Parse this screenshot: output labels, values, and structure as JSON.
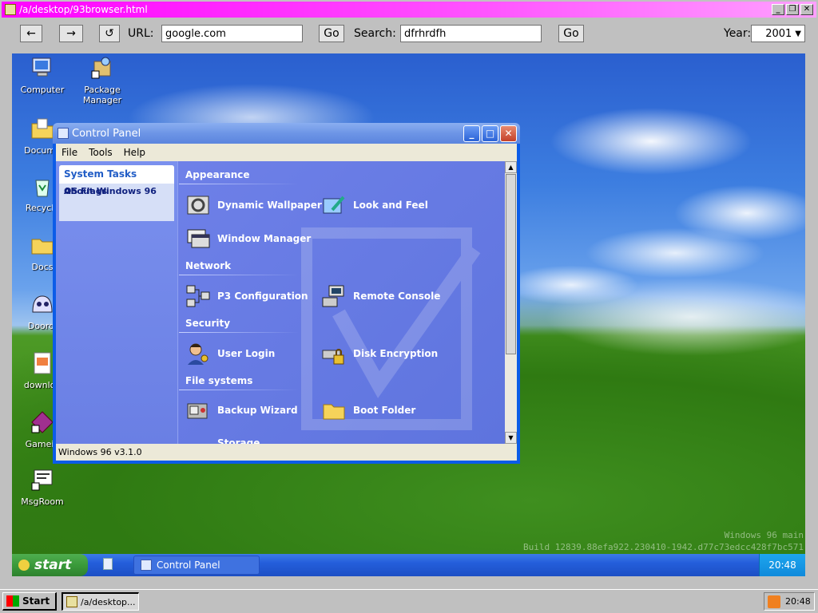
{
  "browser": {
    "title": "/a/desktop/93browser.html",
    "back": "←",
    "forward": "→",
    "reload": "↺",
    "url_label": "URL:",
    "url_value": "google.com",
    "go": "Go",
    "search_label": "Search:",
    "search_value": "dfrhrdfh",
    "go2": "Go",
    "year_label": "Year:",
    "year_value": "2001"
  },
  "desktop": {
    "icons": [
      {
        "label": "Computer",
        "icon": "computer-icon"
      },
      {
        "label": "Package Manager",
        "icon": "package-icon"
      },
      {
        "label": "Docume",
        "icon": "documents-icon"
      },
      {
        "label": "Recycle",
        "icon": "recycle-bin-icon"
      },
      {
        "label": "Docs",
        "icon": "folder-icon"
      },
      {
        "label": "Doordi",
        "icon": "doordiary-icon"
      },
      {
        "label": "downloa",
        "icon": "downloads-icon"
      },
      {
        "label": "Gamein",
        "icon": "gamein-icon"
      },
      {
        "label": "MsgRoom",
        "icon": "msgroom-icon"
      }
    ],
    "watermark_line1": "Windows 96 main",
    "watermark_line2": "Build 12839.88efa922.230410-1942.d77c73edcc428f7bc571"
  },
  "control_panel": {
    "title": "Control Panel",
    "menu": [
      "File",
      "Tools",
      "Help"
    ],
    "system_tasks": {
      "header": "System Tasks",
      "items": [
        "About Windows 96",
        "OS Flags"
      ]
    },
    "categories": [
      {
        "name": "Appearance",
        "items": [
          "Dynamic Wallpaper",
          "Look and Feel",
          "Window Manager"
        ]
      },
      {
        "name": "Network",
        "items": [
          "P3 Configuration",
          "Remote Console"
        ]
      },
      {
        "name": "Security",
        "items": [
          "User Login",
          "Disk Encryption"
        ]
      },
      {
        "name": "File systems",
        "items": [
          "Backup Wizard",
          "Boot Folder"
        ]
      },
      {
        "name": "Storage",
        "items": []
      }
    ],
    "status": "Windows 96 v3.1.0"
  },
  "xp_taskbar": {
    "start": "start",
    "task": "Control Panel",
    "clock": "20:48"
  },
  "host_taskbar": {
    "start": "Start",
    "task": "/a/desktop...",
    "clock": "20:48"
  }
}
